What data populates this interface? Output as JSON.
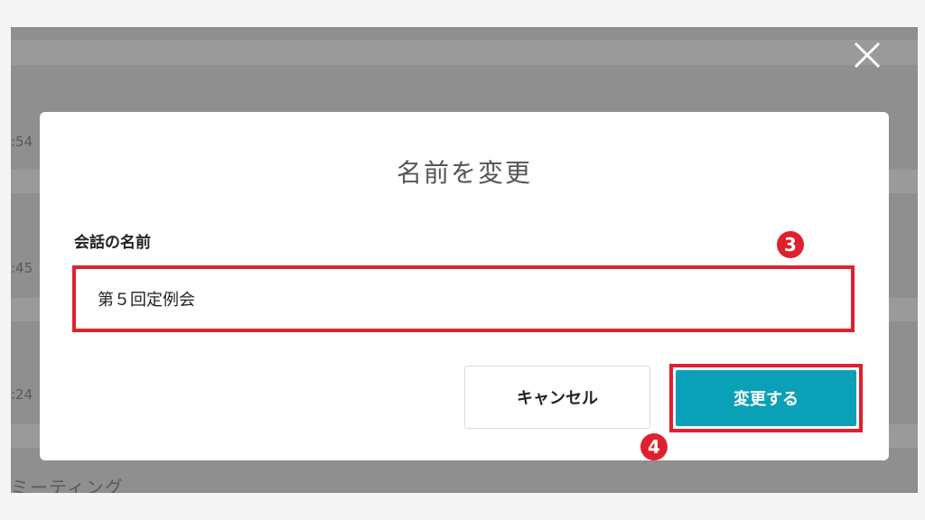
{
  "background": {
    "times": [
      ":54",
      ":45",
      ":24"
    ],
    "partial_title": "ミーティング"
  },
  "dialog": {
    "title": "名前を変更",
    "field_label": "会話の名前",
    "field_value": "第５回定例会",
    "cancel_label": "キャンセル",
    "confirm_label": "変更する"
  },
  "annotations": {
    "step3": "3",
    "step4": "4"
  },
  "colors": {
    "accent": "#0aa1b8",
    "highlight": "#e0202e",
    "overlay": "#8f8f8f"
  },
  "icons": {
    "close": "close-icon"
  }
}
